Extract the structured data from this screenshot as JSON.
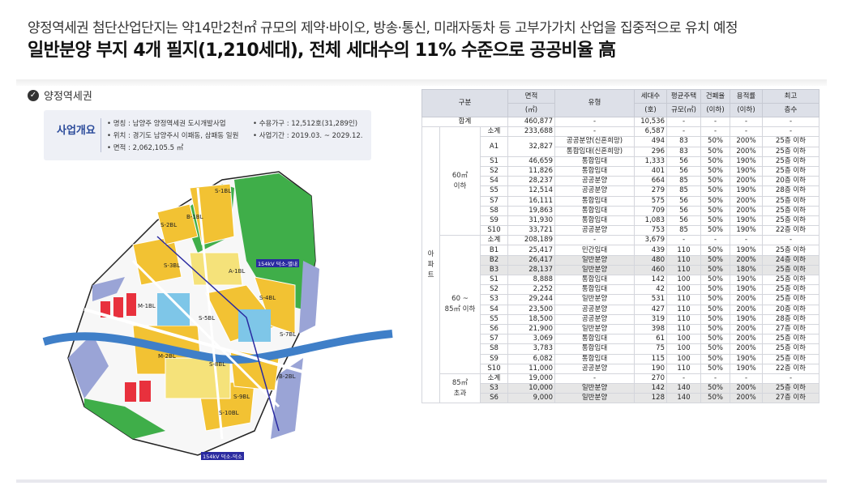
{
  "header": {
    "subtitle": "양정역세권 첨단산업단지는 약14만2천㎡ 규모의 제약·바이오, 방송·통신, 미래자동차 등 고부가가치 산업을 집중적으로 유치 예정",
    "title": "일반분양 부지 4개 필지(1,210세대), 전체 세대수의 11% 수준으로 공공비율 高"
  },
  "section": {
    "label": "양정역세권"
  },
  "overview": {
    "title": "사업개요",
    "items": [
      "• 명칭 : 남양주 양정역세권 도시개발사업",
      "• 위치 : 경기도 남양주시 이패동, 삼패동 일원",
      "• 면적 : 2,062,105.5 ㎡",
      "• 수용가구 : 12,512호(31,289인)",
      "• 사업기간 : 2019.03. ~ 2029.12."
    ]
  },
  "map_labels": [
    "S-1BL",
    "S-2BL",
    "B-1BL",
    "A-1BL",
    "S-4BL",
    "S-3BL",
    "M-1BL",
    "S-5BL",
    "S-7BL",
    "M-2BL",
    "S-8BL",
    "S-9BL",
    "B-2BL",
    "S-10BL",
    "154kV 덕소-별내",
    "154kV 덕소-덕소"
  ],
  "colors": {
    "residential": "#f2c233",
    "apartment": "#f5e27a",
    "commercial": "#e8313d",
    "public": "#9aa4d6",
    "green": "#3fae49",
    "river": "#3f7fc8",
    "industrial": "#7ec6e8"
  },
  "table": {
    "header_top": [
      "구분",
      "면적",
      "유형",
      "세대수",
      "평균주택",
      "건폐율",
      "용적률",
      "최고"
    ],
    "header_bottom": [
      "(㎡)",
      "(호)",
      "규모(㎡)",
      "(이하)",
      "(이하)",
      "층수"
    ],
    "total": {
      "label": "합계",
      "area": "460,877",
      "type": "-",
      "units": "10,536",
      "size": "-",
      "bcr": "-",
      "far": "-",
      "floors": "-"
    },
    "group_label": "아\n파\n트",
    "sections": [
      {
        "label": "60㎡\n이하",
        "rows": [
          {
            "code": "소계",
            "area": "233,688",
            "type": "-",
            "units": "6,587",
            "size": "-",
            "bcr": "-",
            "far": "-",
            "floors": "-",
            "hl": false
          },
          {
            "code": "A1",
            "area": "32,827",
            "type": "공공분양(신혼희망)",
            "units": "494",
            "size": "83",
            "bcr": "50%",
            "far": "200%",
            "floors": "25층 이하",
            "hl": false,
            "span": 2
          },
          {
            "code": "",
            "area": "",
            "type": "통합임대(신혼희망)",
            "units": "296",
            "size": "83",
            "bcr": "50%",
            "far": "200%",
            "floors": "25층 이하",
            "hl": false,
            "merged": true
          },
          {
            "code": "S1",
            "area": "46,659",
            "type": "통합임대",
            "units": "1,333",
            "size": "56",
            "bcr": "50%",
            "far": "190%",
            "floors": "25층 이하",
            "hl": false
          },
          {
            "code": "S2",
            "area": "11,826",
            "type": "통합임대",
            "units": "401",
            "size": "56",
            "bcr": "50%",
            "far": "190%",
            "floors": "25층 이하",
            "hl": false
          },
          {
            "code": "S4",
            "area": "28,237",
            "type": "공공분양",
            "units": "664",
            "size": "85",
            "bcr": "50%",
            "far": "200%",
            "floors": "20층 이하",
            "hl": false
          },
          {
            "code": "S5",
            "area": "12,514",
            "type": "공공분양",
            "units": "279",
            "size": "85",
            "bcr": "50%",
            "far": "190%",
            "floors": "28층 이하",
            "hl": false
          },
          {
            "code": "S7",
            "area": "16,111",
            "type": "통합임대",
            "units": "575",
            "size": "56",
            "bcr": "50%",
            "far": "200%",
            "floors": "25층 이하",
            "hl": false
          },
          {
            "code": "S8",
            "area": "19,863",
            "type": "통합임대",
            "units": "709",
            "size": "56",
            "bcr": "50%",
            "far": "200%",
            "floors": "25층 이하",
            "hl": false
          },
          {
            "code": "S9",
            "area": "31,930",
            "type": "통합임대",
            "units": "1,083",
            "size": "56",
            "bcr": "50%",
            "far": "190%",
            "floors": "25층 이하",
            "hl": false
          },
          {
            "code": "S10",
            "area": "33,721",
            "type": "공공분양",
            "units": "753",
            "size": "85",
            "bcr": "50%",
            "far": "190%",
            "floors": "22층 이하",
            "hl": false
          }
        ]
      },
      {
        "label": "60 ~\n85㎡ 이하",
        "rows": [
          {
            "code": "소계",
            "area": "208,189",
            "type": "-",
            "units": "3,679",
            "size": "-",
            "bcr": "-",
            "far": "-",
            "floors": "-",
            "hl": false
          },
          {
            "code": "B1",
            "area": "25,417",
            "type": "민간임대",
            "units": "439",
            "size": "110",
            "bcr": "50%",
            "far": "190%",
            "floors": "25층 이하",
            "hl": false
          },
          {
            "code": "B2",
            "area": "26,417",
            "type": "일반분양",
            "units": "480",
            "size": "110",
            "bcr": "50%",
            "far": "200%",
            "floors": "24층 이하",
            "hl": true
          },
          {
            "code": "B3",
            "area": "28,137",
            "type": "일반분양",
            "units": "460",
            "size": "110",
            "bcr": "50%",
            "far": "180%",
            "floors": "25층 이하",
            "hl": true
          },
          {
            "code": "S1",
            "area": "8,888",
            "type": "통합임대",
            "units": "142",
            "size": "100",
            "bcr": "50%",
            "far": "190%",
            "floors": "25층 이하",
            "hl": false
          },
          {
            "code": "S2",
            "area": "2,252",
            "type": "통합임대",
            "units": "42",
            "size": "100",
            "bcr": "50%",
            "far": "190%",
            "floors": "25층 이하",
            "hl": false
          },
          {
            "code": "S3",
            "area": "29,244",
            "type": "일반분양",
            "units": "531",
            "size": "110",
            "bcr": "50%",
            "far": "200%",
            "floors": "25층 이하",
            "hl": false
          },
          {
            "code": "S4",
            "area": "23,500",
            "type": "공공분양",
            "units": "427",
            "size": "110",
            "bcr": "50%",
            "far": "200%",
            "floors": "20층 이하",
            "hl": false
          },
          {
            "code": "S5",
            "area": "18,500",
            "type": "공공분양",
            "units": "319",
            "size": "110",
            "bcr": "50%",
            "far": "190%",
            "floors": "28층 이하",
            "hl": false
          },
          {
            "code": "S6",
            "area": "21,900",
            "type": "일반분양",
            "units": "398",
            "size": "110",
            "bcr": "50%",
            "far": "200%",
            "floors": "27층 이하",
            "hl": false
          },
          {
            "code": "S7",
            "area": "3,069",
            "type": "통합임대",
            "units": "61",
            "size": "100",
            "bcr": "50%",
            "far": "200%",
            "floors": "25층 이하",
            "hl": false
          },
          {
            "code": "S8",
            "area": "3,783",
            "type": "통합임대",
            "units": "75",
            "size": "100",
            "bcr": "50%",
            "far": "200%",
            "floors": "25층 이하",
            "hl": false
          },
          {
            "code": "S9",
            "area": "6,082",
            "type": "통합임대",
            "units": "115",
            "size": "100",
            "bcr": "50%",
            "far": "190%",
            "floors": "25층 이하",
            "hl": false
          },
          {
            "code": "S10",
            "area": "11,000",
            "type": "공공분양",
            "units": "190",
            "size": "110",
            "bcr": "50%",
            "far": "190%",
            "floors": "22층 이하",
            "hl": false
          }
        ]
      },
      {
        "label": "85㎡\n초과",
        "rows": [
          {
            "code": "소계",
            "area": "19,000",
            "type": "-",
            "units": "270",
            "size": "-",
            "bcr": "-",
            "far": "-",
            "floors": "-",
            "hl": false
          },
          {
            "code": "S3",
            "area": "10,000",
            "type": "일반분양",
            "units": "142",
            "size": "140",
            "bcr": "50%",
            "far": "200%",
            "floors": "25층 이하",
            "hl": true
          },
          {
            "code": "S6",
            "area": "9,000",
            "type": "일반분양",
            "units": "128",
            "size": "140",
            "bcr": "50%",
            "far": "200%",
            "floors": "27층 이하",
            "hl": true
          }
        ]
      }
    ]
  }
}
